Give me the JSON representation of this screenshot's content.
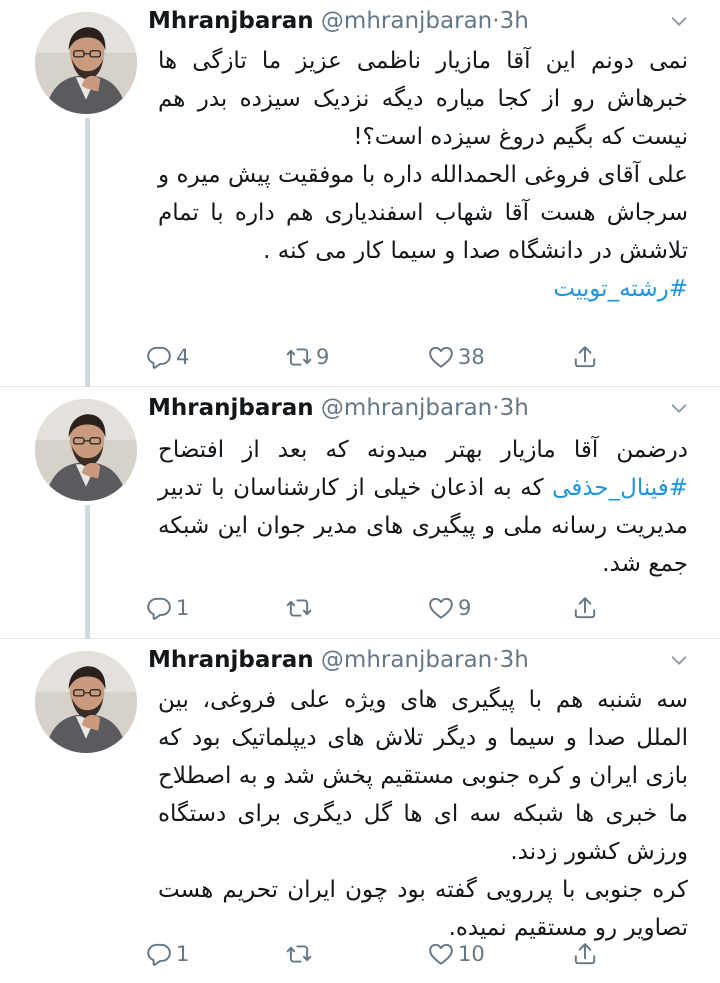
{
  "tweets": [
    {
      "name": "Mhranjbaran",
      "handle": "@mhranjbaran",
      "separator": "·",
      "time": "3h",
      "paragraphs": [
        "نمی دونم این آقا مازیار ناظمی عزیز ما تازگی ها خبرهاش رو از کجا میاره دیگه نزدیک سیزده بدر هم نیست که بگیم دروغ سیزده است؟!",
        "علی آقای فروغی الحمدالله داره با موفقیت پیش میره و سرجاش هست آقا شهاب اسفندیاری هم داره با تمام تلاشش در دانشگاه صدا و سیما کار می کنه ."
      ],
      "hashtag": "#رشته_توییت",
      "replies": "4",
      "retweets": "9",
      "likes": "38"
    },
    {
      "name": "Mhranjbaran",
      "handle": "@mhranjbaran",
      "separator": "·",
      "time": "3h",
      "text_before": "درضمن آقا مازیار بهتر میدونه که بعد از افتضاح",
      "hashtag": "#فینال_حذفی",
      "text_after": "که به اذعان خیلی از کارشناسان با تدبیر مدیریت رسانه ملی و پیگیری های مدیر جوان این شبکه جمع شد.",
      "replies": "1",
      "retweets": "",
      "likes": "9"
    },
    {
      "name": "Mhranjbaran",
      "handle": "@mhranjbaran",
      "separator": "·",
      "time": "3h",
      "paragraphs": [
        "سه شنبه هم با پیگیری های ویژه علی فروغی، بین الملل صدا و سیما و دیگر تلاش های دیپلماتیک بود که بازی ایران و کره جنوبی مستقیم پخش شد و به اصطلاح ما خبری ها شبکه سه ای ها گل دیگری برای دستگاه ورزش کشور زدند.",
        "کره جنوبی با پررویی گفته بود چون ایران تحریم هست تصاویر رو مستقیم نمیده."
      ],
      "replies": "1",
      "retweets": "",
      "likes": "10"
    }
  ]
}
